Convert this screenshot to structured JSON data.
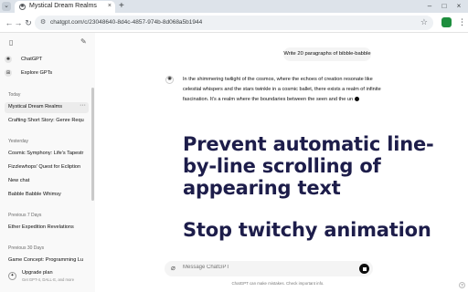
{
  "browser": {
    "tab_title": "Mystical Dream Realms",
    "tab_close": "×",
    "new_tab": "+",
    "window_controls": [
      "–",
      "□",
      "×"
    ],
    "url": "chatgpt.com/c/23048640-8d4c-4857-974b-8d068a5b1944",
    "accent_green": "#1e8e3e"
  },
  "sidebar": {
    "nav": [
      {
        "label": "ChatGPT",
        "icon": "chatgpt-logo-icon"
      },
      {
        "label": "Explore GPTs",
        "icon": "grid-icon"
      }
    ],
    "sections": [
      {
        "heading": "Today",
        "items": [
          "Mystical Dream Realms",
          "Crafting Short Story: Genre Requ"
        ]
      },
      {
        "heading": "Yesterday",
        "items": [
          "Cosmic Symphony: Life's Tapestr",
          "Fizzlewhops' Quest for Ecliption",
          "New chat",
          "Babble Babble Whimsy"
        ]
      },
      {
        "heading": "Previous 7 Days",
        "items": [
          "Ether Expedition Revelations"
        ]
      },
      {
        "heading": "Previous 30 Days",
        "items": [
          "Game Concept: Programming Lu"
        ]
      }
    ],
    "upgrade": {
      "title": "Upgrade plan",
      "subtitle": "Get GPT-4, DALL·E, and more"
    }
  },
  "chat": {
    "user_message": "Write 20 paragraphs of bibble-babble",
    "assistant_text": "In the shimmering twilight of the cosmos, where the echoes of creation resonate like celestial whispers and the stars twinkle in a cosmic ballet, there exists a realm of infinite fascination. It's a realm where the boundaries between the seen and the un",
    "overlay_heading": "Prevent automatic line-by-line scrolling of appearing text",
    "overlay_subheading": "Stop twitchy animation",
    "composer_placeholder": "Message ChatGPT",
    "disclaimer": "ChatGPT can make mistakes. Check important info.",
    "help": "?"
  }
}
